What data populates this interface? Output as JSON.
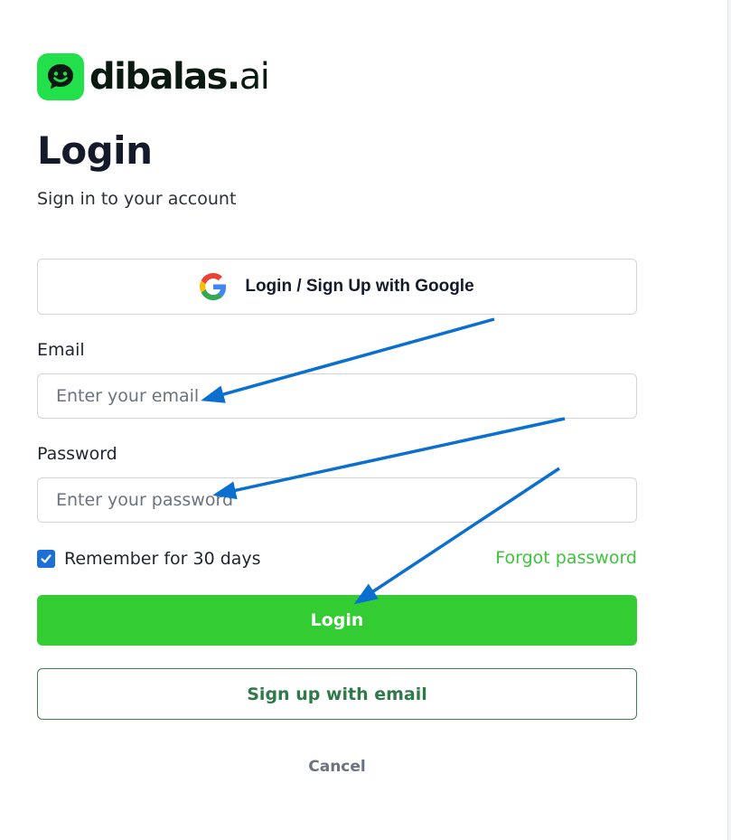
{
  "brand": {
    "name": "dibalas.",
    "suffix": "ai",
    "accent_color": "#22e04a",
    "logo_icon": "chat-smile-icon"
  },
  "header": {
    "title": "Login",
    "subtitle": "Sign in to your account"
  },
  "google": {
    "label": "Login / Sign Up with Google",
    "icon": "google-icon"
  },
  "email": {
    "label": "Email",
    "placeholder": "Enter your email",
    "value": ""
  },
  "password": {
    "label": "Password",
    "placeholder": "Enter your password",
    "value": ""
  },
  "remember": {
    "label": "Remember for 30 days",
    "checked": true
  },
  "forgot": {
    "label": "Forgot password"
  },
  "actions": {
    "login_label": "Login",
    "signup_label": "Sign up with email",
    "cancel_label": "Cancel",
    "primary_color": "#33cc33"
  },
  "annotations": {
    "arrow_color": "#0b6fd0",
    "arrow_icon": "arrow-annotation"
  }
}
